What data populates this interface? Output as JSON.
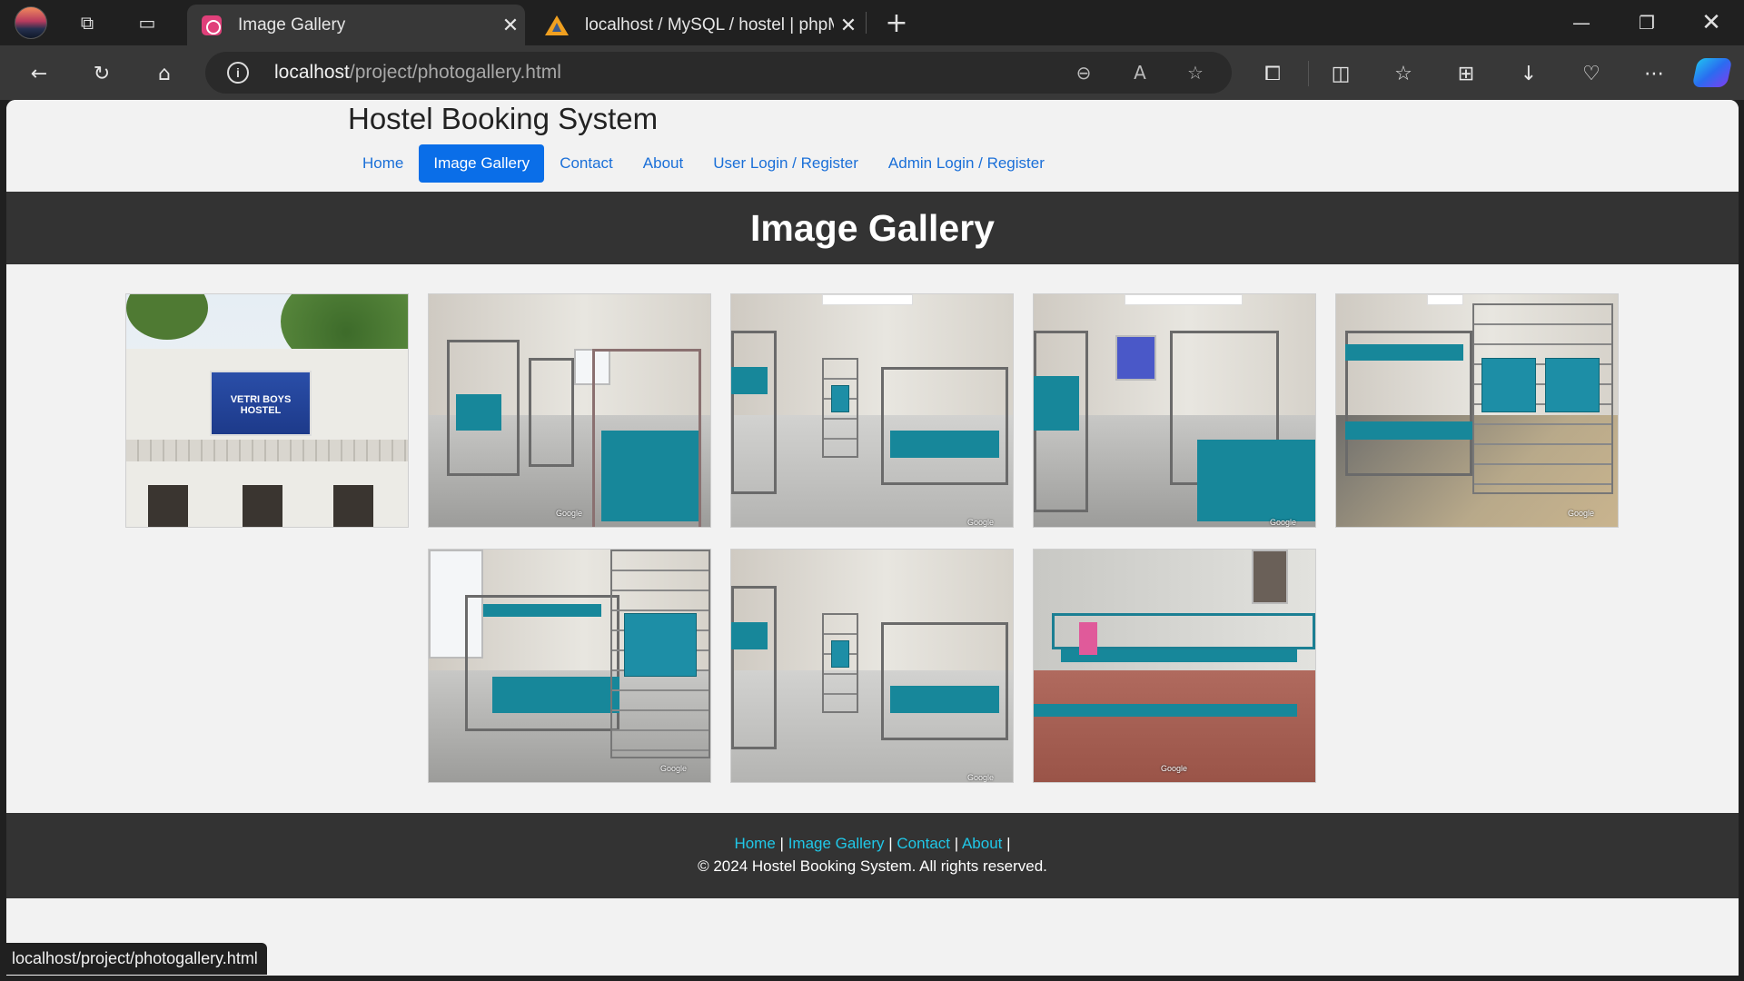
{
  "browser": {
    "tabs": [
      {
        "title": "Image Gallery",
        "active": true
      },
      {
        "title": "localhost / MySQL / hostel | phpM",
        "active": false
      }
    ],
    "close_glyph": "✕",
    "new_tab_glyph": "+",
    "window_controls": {
      "minimize": "—",
      "restore": "❐",
      "close": "✕"
    },
    "address": {
      "host": "localhost",
      "path": "/project/photogallery.html"
    },
    "status_url": "localhost/project/photogallery.html"
  },
  "site": {
    "title": "Hostel Booking System",
    "menu": [
      {
        "label": "Home",
        "active": false
      },
      {
        "label": "Image Gallery",
        "active": true
      },
      {
        "label": "Contact",
        "active": false
      },
      {
        "label": "About",
        "active": false
      },
      {
        "label": "User Login / Register",
        "active": false
      },
      {
        "label": "Admin Login / Register",
        "active": false
      }
    ]
  },
  "gallery": {
    "heading": "Image Gallery",
    "photos": [
      {
        "type": "hostel-exterior",
        "sign_text": "VETRI BOYS HOSTEL"
      },
      {
        "type": "dorm-room",
        "watermark": "Google"
      },
      {
        "type": "dorm-room",
        "watermark": "Google"
      },
      {
        "type": "dorm-room",
        "watermark": "Google"
      },
      {
        "type": "dorm-room",
        "watermark": "Google"
      },
      {
        "type": "dorm-room",
        "watermark": "Google"
      },
      {
        "type": "dorm-room",
        "watermark": "Google"
      },
      {
        "type": "dining-room",
        "watermark": "Google"
      }
    ]
  },
  "footer": {
    "links": [
      "Home",
      "Image Gallery",
      "Contact",
      "About"
    ],
    "separator": "|",
    "copyright": "© 2024 Hostel Booking System. All rights reserved."
  },
  "colors": {
    "accent": "#0a6ee8",
    "footer_link": "#20c8e8",
    "dark_band": "#333333"
  }
}
